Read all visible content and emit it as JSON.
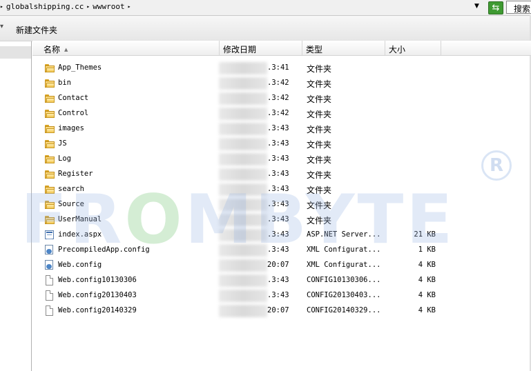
{
  "address_bar": {
    "segments": [
      "globalshipping.cc",
      "wwwroot"
    ],
    "search_placeholder": "搜索"
  },
  "toolbar": {
    "new_folder_label": "新建文件夹"
  },
  "columns": {
    "name": "名称",
    "date": "修改日期",
    "type": "类型",
    "size": "大小"
  },
  "files": [
    {
      "name": "App_Themes",
      "time": ".3:41",
      "type": "文件夹",
      "size": "",
      "icon": "folder-icon"
    },
    {
      "name": "bin",
      "time": ".3:42",
      "type": "文件夹",
      "size": "",
      "icon": "folder-icon"
    },
    {
      "name": "Contact",
      "time": ".3:42",
      "type": "文件夹",
      "size": "",
      "icon": "folder-icon"
    },
    {
      "name": "Control",
      "time": ".3:42",
      "type": "文件夹",
      "size": "",
      "icon": "folder-icon"
    },
    {
      "name": "images",
      "time": ".3:43",
      "type": "文件夹",
      "size": "",
      "icon": "folder-icon"
    },
    {
      "name": "JS",
      "time": ".3:43",
      "type": "文件夹",
      "size": "",
      "icon": "folder-icon"
    },
    {
      "name": "Log",
      "time": ".3:43",
      "type": "文件夹",
      "size": "",
      "icon": "folder-icon"
    },
    {
      "name": "Register",
      "time": ".3:43",
      "type": "文件夹",
      "size": "",
      "icon": "folder-icon"
    },
    {
      "name": "search",
      "time": ".3:43",
      "type": "文件夹",
      "size": "",
      "icon": "folder-icon"
    },
    {
      "name": "Source",
      "time": ".3:43",
      "type": "文件夹",
      "size": "",
      "icon": "folder-icon"
    },
    {
      "name": "UserManual",
      "time": ".3:43",
      "type": "文件夹",
      "size": "",
      "icon": "folder-icon"
    },
    {
      "name": "index.aspx",
      "time": ".3:43",
      "type": "ASP.NET Server...",
      "size": "21 KB",
      "icon": "aspx-file-icon"
    },
    {
      "name": "PrecompiledApp.config",
      "time": ".3:43",
      "type": "XML Configurat...",
      "size": "1 KB",
      "icon": "config-file-icon"
    },
    {
      "name": "Web.config",
      "time": "20:07",
      "type": "XML Configurat...",
      "size": "4 KB",
      "icon": "config-file-icon"
    },
    {
      "name": "Web.config10130306",
      "time": ".3:43",
      "type": "CONFIG10130306...",
      "size": "4 KB",
      "icon": "file-icon"
    },
    {
      "name": "Web.config20130403",
      "time": ".3:43",
      "type": "CONFIG20130403...",
      "size": "4 KB",
      "icon": "file-icon"
    },
    {
      "name": "Web.config20140329",
      "time": "20:07",
      "type": "CONFIG20140329...",
      "size": "4 KB",
      "icon": "file-icon"
    }
  ],
  "watermark": {
    "text_a": "FR",
    "text_o": "O",
    "text_b": "MBYTE",
    "mark": "R"
  },
  "colors": {
    "watermark": "#96b4e1",
    "refresh_button": "#3f9a32",
    "folder": "#eab53a"
  }
}
